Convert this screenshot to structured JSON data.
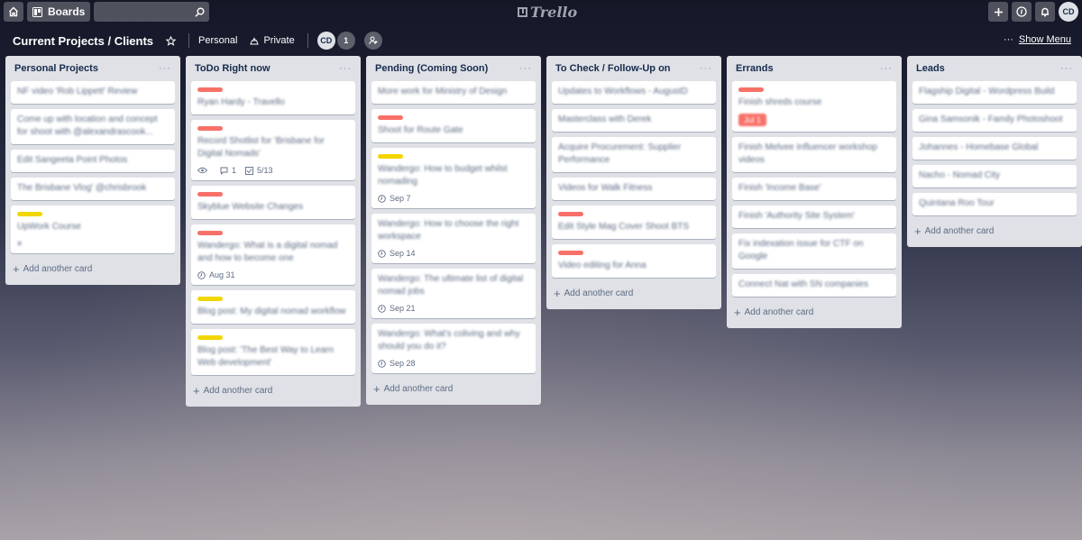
{
  "topbar": {
    "home_icon": "home-icon",
    "boards_label": "Boards",
    "search_value": "",
    "logo_text": "Trello",
    "create_icon": "plus-icon",
    "info_icon": "info-icon",
    "notifications_icon": "bell-icon",
    "user_initials": "CD"
  },
  "board": {
    "title": "Current Projects / Clients",
    "team": "Personal",
    "visibility": "Private",
    "member_initials": "CD",
    "member_extra_count": "1",
    "show_menu": "Show Menu",
    "more": "···"
  },
  "colors": {
    "label_red": "#f87168",
    "label_yellow": "#f2d600",
    "list_bg": "#dfe1e6",
    "card_bg": "#ffffff"
  },
  "add_card_label": "Add another card",
  "lists": [
    {
      "title": "Personal Projects",
      "cards": [
        {
          "text": "NF video 'Rob Lippett' Review"
        },
        {
          "text": "Come up with location and concept for shoot with @alexandrascook..."
        },
        {
          "text": "Edit Sangeeta Point Photos"
        },
        {
          "text": "The Brisbane Vlog' @chrisbrook"
        },
        {
          "label": "yellow",
          "text": "UpWork Course",
          "badge": "≡"
        }
      ]
    },
    {
      "title": "ToDo Right now",
      "cards": [
        {
          "label": "red",
          "text": "Ryan Hardy - Travello"
        },
        {
          "label": "red",
          "text": "Record Shotlist for 'Brisbane for Digital Nomads'",
          "watch": true,
          "comments": "1",
          "checklist": "5/13"
        },
        {
          "label": "red",
          "text": "Skyblue Website Changes"
        },
        {
          "label": "red",
          "text": "Wandergo: What is a digital nomad and how to become one",
          "due": "Aug 31"
        },
        {
          "label": "yellow",
          "text": "Blog post: My digital nomad workflow"
        },
        {
          "label": "yellow",
          "text": "Blog post: 'The Best Way to Learn Web development'"
        }
      ]
    },
    {
      "title": "Pending (Coming Soon)",
      "cards": [
        {
          "text": "More work for Ministry of Design"
        },
        {
          "label": "red",
          "text": "Shoot for Route Gate"
        },
        {
          "label": "yellow",
          "text": "Wandergo: How to budget whilst nomading",
          "due": "Sep 7"
        },
        {
          "text": "Wandergo: How to choose the right workspace",
          "due": "Sep 14"
        },
        {
          "text": "Wandergo: The ultimate list of digital nomad jobs",
          "due": "Sep 21"
        },
        {
          "text": "Wandergo: What's coliving and why should you do it?",
          "due": "Sep 28"
        }
      ]
    },
    {
      "title": "To Check / Follow-Up on",
      "cards": [
        {
          "text": "Updates to Workflows - AugustD"
        },
        {
          "text": "Masterclass with Derek"
        },
        {
          "text": "Acquire Procurement: Supplier Performance"
        },
        {
          "text": "Videos for Walk Fitness"
        },
        {
          "label": "red",
          "text": "Edit Style Mag Cover Shoot BTS"
        },
        {
          "label": "red",
          "text": "Video editing for Anna"
        }
      ]
    },
    {
      "title": "Errands",
      "cards": [
        {
          "label": "red",
          "text": "Finish shreds course",
          "due_overdue": "Jul 1"
        },
        {
          "text": "Finish Melvee Influencer workshop videos"
        },
        {
          "text": "Finish 'Income Base'"
        },
        {
          "text": "Finish 'Authority Site System'"
        },
        {
          "text": "Fix indexation issue for CTF on Google"
        },
        {
          "text": "Connect Nat with SN companies"
        }
      ]
    },
    {
      "title": "Leads",
      "cards": [
        {
          "text": "Flagship Digital - Wordpress Build"
        },
        {
          "text": "Gina Samsonik - Family Photoshoot"
        },
        {
          "text": "Johannes - Homebase Global"
        },
        {
          "text": "Nacho - Nomad City"
        },
        {
          "text": "Quintana Roo Tour"
        }
      ]
    }
  ]
}
